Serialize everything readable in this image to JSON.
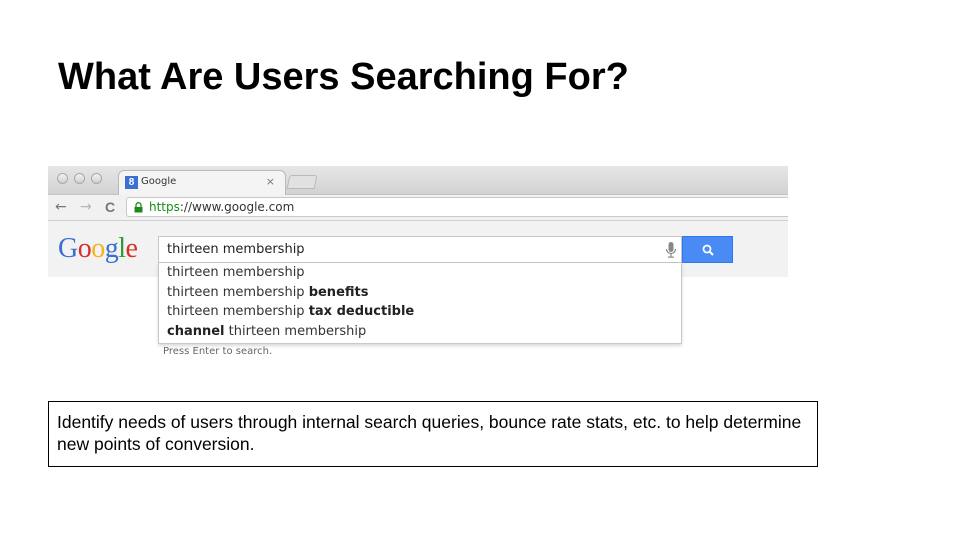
{
  "slide": {
    "title": "What Are Users Searching For?",
    "caption": "Identify needs of users through internal search queries, bounce rate stats, etc. to help determine new points of conversion."
  },
  "browser": {
    "tab": {
      "favicon_letter": "8",
      "title": "Google",
      "close_glyph": "×"
    },
    "nav": {
      "back_glyph": "←",
      "forward_glyph": "→",
      "reload_glyph": "C"
    },
    "address": {
      "scheme": "https",
      "rest": "://www.google.com"
    },
    "icons": [
      "lock-icon",
      "mic-icon",
      "search-icon"
    ],
    "colors": {
      "search_button": "#4a8af4",
      "https_green": "#1a8a1a",
      "logo": [
        "#3b6fd2",
        "#d6302c",
        "#f2b619",
        "#3b6fd2",
        "#2c9a3f",
        "#d6302c"
      ]
    }
  },
  "google": {
    "logo_letters": [
      "G",
      "o",
      "o",
      "g",
      "l",
      "e"
    ],
    "query": "thirteen membership",
    "suggestions": [
      {
        "normal_before": "thirteen membership",
        "bold": "",
        "normal_after": ""
      },
      {
        "normal_before": "thirteen membership ",
        "bold": "benefits",
        "normal_after": ""
      },
      {
        "normal_before": "thirteen membership ",
        "bold": "tax deductible",
        "normal_after": ""
      },
      {
        "normal_before": "",
        "bold": "channel",
        "normal_after": " thirteen membership"
      }
    ],
    "hint": "Press Enter to search."
  }
}
